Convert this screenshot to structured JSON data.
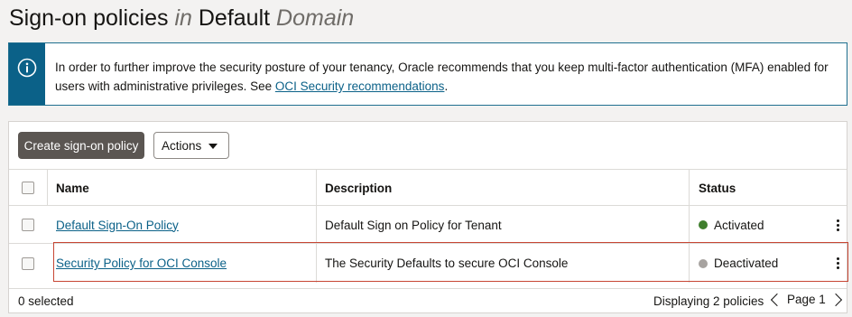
{
  "page": {
    "title_part1": "Sign-on policies",
    "title_in": "in",
    "title_part2": "Default",
    "title_domain": "Domain"
  },
  "banner": {
    "text_before_link": "In order to further improve the security posture of your tenancy, Oracle recommends that you keep multi-factor authentication (MFA) enabled for users with administrative privileges. See ",
    "link_text": "OCI Security recommendations",
    "text_after_link": ".",
    "icon": "info-icon"
  },
  "toolbar": {
    "create_label": "Create sign-on policy",
    "actions_label": "Actions"
  },
  "table": {
    "headers": {
      "name": "Name",
      "description": "Description",
      "status": "Status"
    },
    "rows": [
      {
        "name": "Default Sign-On Policy",
        "description": "Default Sign on Policy for Tenant",
        "status": "Activated",
        "status_color": "#3f7e2d"
      },
      {
        "name": "Security Policy for OCI Console",
        "description": "The Security Defaults to secure OCI Console",
        "status": "Deactivated",
        "status_color": "#a7a3a0"
      }
    ]
  },
  "footer": {
    "selected": "0 selected",
    "displaying": "Displaying 2 policies",
    "page_label": "Page 1"
  },
  "colors": {
    "accent": "#0b6188",
    "primary_button": "#5b5652",
    "highlight": "#c74634"
  }
}
